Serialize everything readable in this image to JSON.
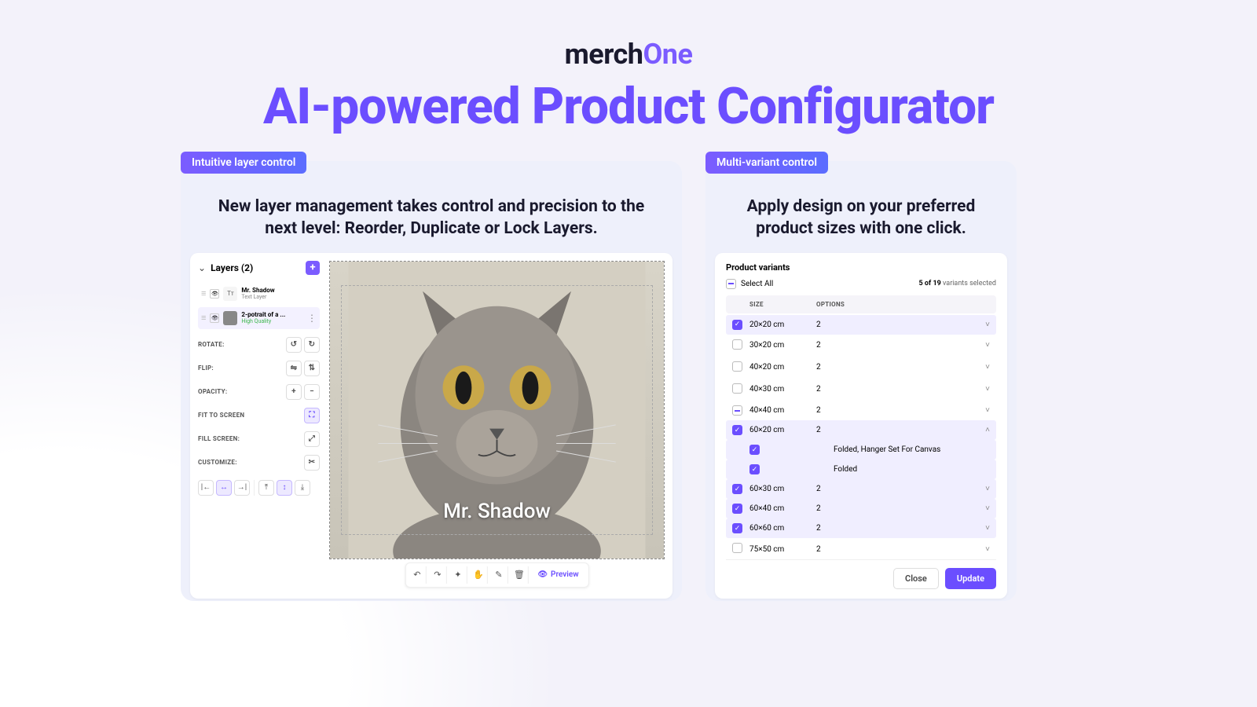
{
  "brand": {
    "part1": "merch",
    "part2": "One"
  },
  "page_title": "AI-powered Product Configurator",
  "left_panel": {
    "pill": "Intuitive layer control",
    "heading": "New layer management takes control and precision to the next level: Reorder, Duplicate or Lock Layers.",
    "layers_header": "Layers (2)",
    "layers": [
      {
        "name": "Mr. Shadow",
        "sub": "Text Layer",
        "type": "text"
      },
      {
        "name": "2-potrait of a ...",
        "sub": "High Quality",
        "type": "image"
      }
    ],
    "props": {
      "rotate": "ROTATE:",
      "flip": "FLIP:",
      "opacity": "OPACITY:",
      "fit": "FIT TO SCREEN",
      "fill": "FILL SCREEN:",
      "customize": "CUSTOMIZE:"
    },
    "canvas_caption": "Mr. Shadow",
    "preview_label": "Preview"
  },
  "right_panel": {
    "pill": "Multi-variant control",
    "heading": "Apply design on your preferred product sizes with one click.",
    "title": "Product variants",
    "select_all": "Select All",
    "count_text": "5 of 19",
    "count_suffix": "variants selected",
    "columns": {
      "size": "SIZE",
      "options": "OPTIONS"
    },
    "rows": [
      {
        "checked": true,
        "size": "20×20 cm",
        "options": "2",
        "expanded": false
      },
      {
        "checked": false,
        "size": "30×20 cm",
        "options": "2",
        "expanded": false
      },
      {
        "checked": false,
        "size": "40×20 cm",
        "options": "2",
        "expanded": false
      },
      {
        "checked": false,
        "size": "40×30 cm",
        "options": "2",
        "expanded": false
      },
      {
        "checked": "semi",
        "size": "40×40 cm",
        "options": "2",
        "expanded": false
      },
      {
        "checked": true,
        "size": "60×20 cm",
        "options": "2",
        "expanded": true
      },
      {
        "checked": true,
        "size": "",
        "options": "Folded, Hanger Set For Canvas",
        "sub": true
      },
      {
        "checked": true,
        "size": "",
        "options": "Folded",
        "sub": true
      },
      {
        "checked": true,
        "size": "60×30 cm",
        "options": "2",
        "expanded": false
      },
      {
        "checked": true,
        "size": "60×40 cm",
        "options": "2",
        "expanded": false
      },
      {
        "checked": true,
        "size": "60×60 cm",
        "options": "2",
        "expanded": false
      },
      {
        "checked": false,
        "size": "75×50 cm",
        "options": "2",
        "expanded": false
      }
    ],
    "close": "Close",
    "update": "Update"
  }
}
